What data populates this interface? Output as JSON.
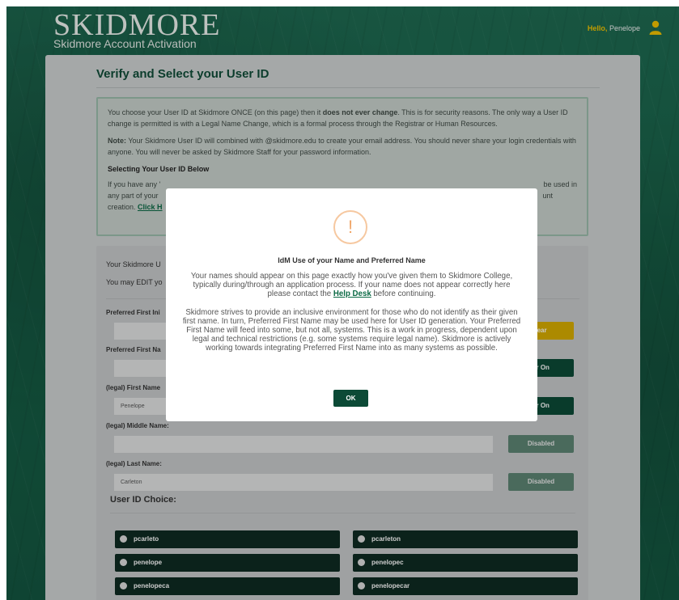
{
  "header": {
    "logo_word": "SKIDMORE",
    "logo_subtitle": "Skidmore Account Activation",
    "greeting_hello": "Hello,",
    "greeting_name": "Penelope"
  },
  "page": {
    "title": "Verify and Select your User ID"
  },
  "info": {
    "p1_before": "You choose your User ID at Skidmore ONCE (on this page) then it ",
    "p1_bold": "does not ever change",
    "p1_after": ". This is for security reasons. The only way a User ID change is permitted is with a Legal Name Change, which is a formal process through the Registrar or Human Resources.",
    "note_label": "Note:",
    "note_text": " Your Skidmore User ID will combined with @skidmore.edu to create your email address. You should never share your login credentials with anyone. You will never be asked by Skidmore Staff for your password information.",
    "selecting_heading": "Selecting Your User ID Below",
    "selecting_line1": "If you have any '",
    "selecting_line1_end": "be used in",
    "selecting_line2": "any part of your",
    "selecting_line2_end": "unt",
    "selecting_line3": "creation. ",
    "click_link": "Click H"
  },
  "form": {
    "line1": "Your Skidmore U",
    "line2": "You may EDIT yo",
    "fields": [
      {
        "label": "Preferred First Ini",
        "value": "",
        "button": "lear"
      },
      {
        "label": "Preferred First Na",
        "value": "",
        "button": "er On"
      },
      {
        "label": "(legal) First Name",
        "value": "Penelope",
        "button": "er On"
      },
      {
        "label": "(legal) Middle Name:",
        "value": "",
        "button": "Disabled"
      },
      {
        "label": "(legal) Last Name:",
        "value": "Carleton",
        "button": "Disabled"
      }
    ],
    "choice_title": "User ID Choice:",
    "user_ids": [
      "pcarleto",
      "pcarleton",
      "penelope",
      "penelopec",
      "penelopeca",
      "penelopecar"
    ]
  },
  "modal": {
    "icon": "exclamation-icon",
    "icon_glyph": "!",
    "title": "IdM Use of your Name and Preferred Name",
    "p1_before": "Your names should appear on this page exactly how you've given them to Skidmore College, typically during/through an application process. If your name does not appear correctly here please contact the ",
    "p1_link": "Help Desk",
    "p1_after": " before continuing.",
    "p2": "Skidmore strives to provide an inclusive environment for those who do not identify as their given first name. In turn, Preferred First Name may be used here for User ID generation. Your Preferred First Name will feed into some, but not all, systems. This is a work in progress, dependent upon legal and technical restrictions (e.g. some systems require legal name). Skidmore is actively working towards integrating Preferred First Name into as many systems as possible.",
    "ok_label": "OK"
  },
  "colors": {
    "brand_green": "#0c4a36",
    "accent_yellow": "#d8ad00",
    "link_green": "#0b6a45"
  }
}
